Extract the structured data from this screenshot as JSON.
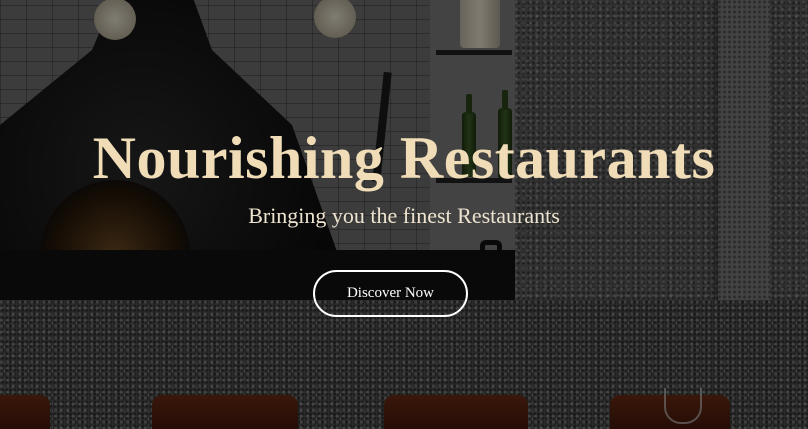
{
  "hero": {
    "title": "Nourishing Restaurants",
    "subtitle": "Bringing you the finest Restaurants",
    "cta_label": "Discover Now"
  },
  "colors": {
    "title": "#f0ddb8",
    "subtitle": "#ede3cf",
    "button_border": "#ffffff",
    "overlay": "rgba(0,0,0,0.45)"
  },
  "background": {
    "description_icon": "restaurant-interior-photo"
  }
}
